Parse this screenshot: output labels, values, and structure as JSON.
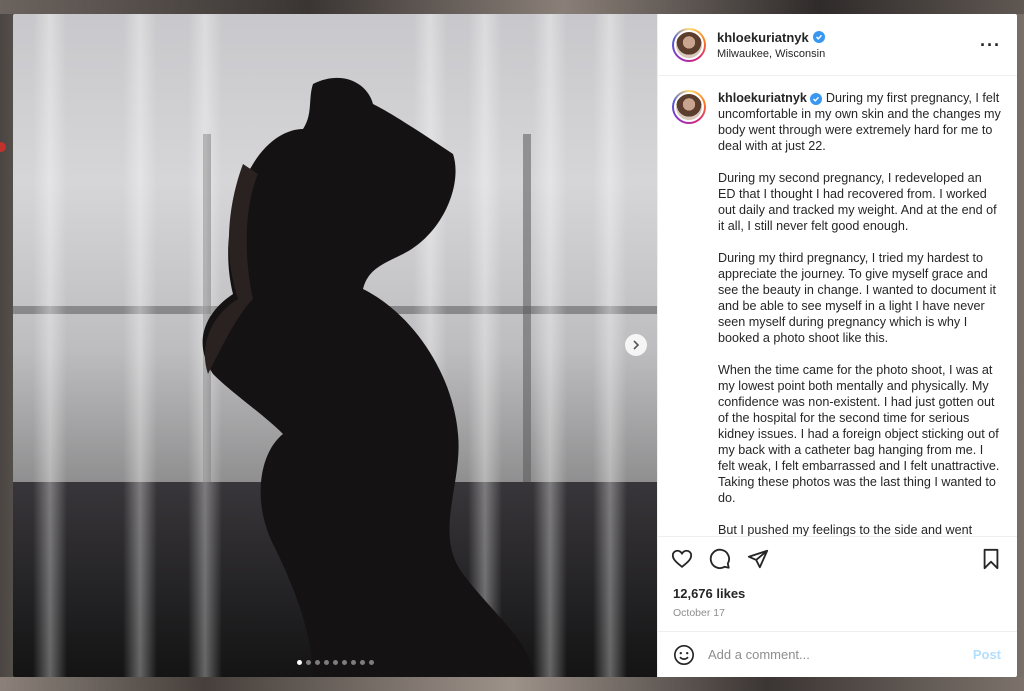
{
  "post": {
    "username": "khloekuriatnyk",
    "location": "Milwaukee, Wisconsin",
    "more_label": "···",
    "caption": [
      "During my first pregnancy, I felt uncomfortable in my own skin and the changes my body went through were extremely hard for me to deal with at just 22.",
      "During my second pregnancy, I redeveloped an ED that I thought I had recovered from. I worked out daily and tracked my weight. And at the end of it all, I still never felt good enough.",
      "During my third pregnancy, I tried my hardest to appreciate the journey. To give myself grace and see the beauty in change. I wanted to document it and be able to see myself in a light I have never seen myself during pregnancy which is why I booked a photo shoot like this.",
      "When the time came for the photo shoot, I was at my lowest point both mentally and physically. My confidence was non-existent. I had just gotten out of the hospital for the second time for serious kidney issues. I had a foreign object sticking out of my back with a catheter bag hanging from me. I felt weak, I felt embarrassed and I felt unattractive. Taking these photos was the last thing I wanted to do.",
      "But I pushed my feelings to the side and went"
    ],
    "likes": "12,676 likes",
    "date": "October 17",
    "carousel_count": 9,
    "carousel_active": 0
  },
  "comment": {
    "placeholder": "Add a comment...",
    "post_label": "Post"
  },
  "icons": {
    "like": "heart-icon",
    "comment": "comment-icon",
    "share": "paper-plane-icon",
    "save": "bookmark-icon",
    "emoji": "emoji-icon",
    "next": "chevron-right-icon",
    "verified": "verified-badge-icon"
  },
  "colors": {
    "verified": "#3897f0",
    "post_button": "#b2dffc",
    "muted_text": "#8e8e8e"
  }
}
